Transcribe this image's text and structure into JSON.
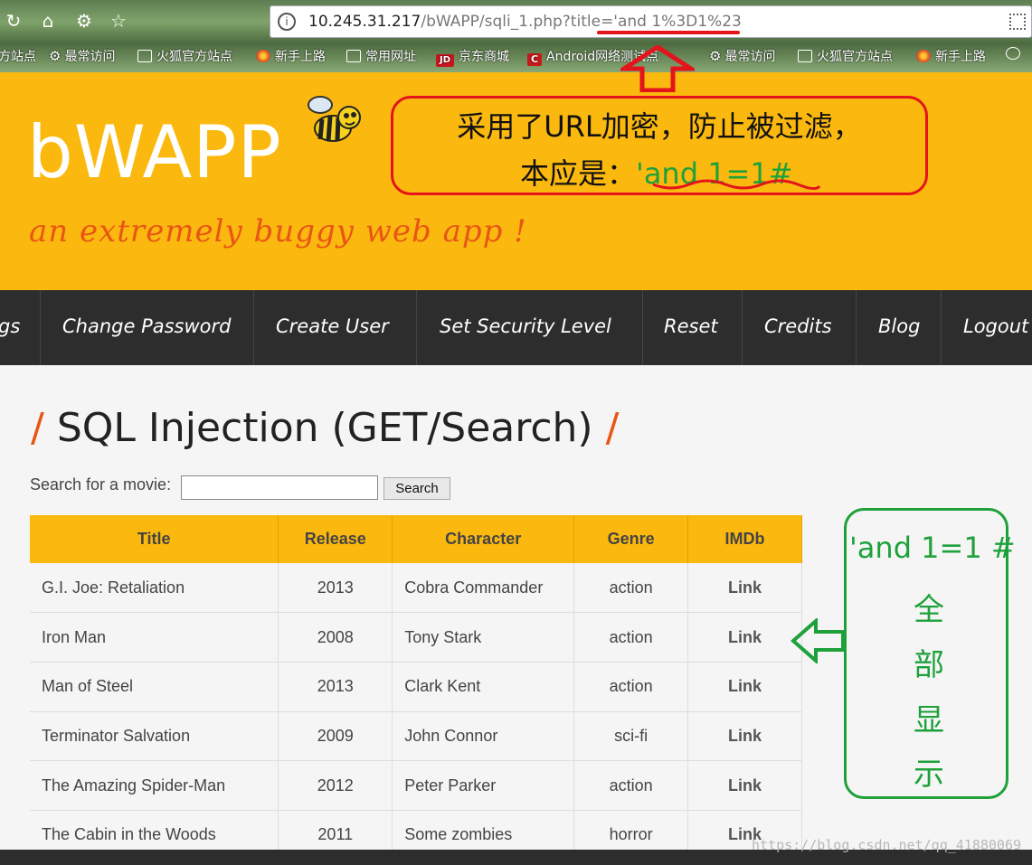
{
  "browser": {
    "url_host": "10.245.31.217",
    "url_path": "/bWAPP/sqli_1.php?title='and 1%3D1%23",
    "bookmarks": [
      "方站点",
      "最常访问",
      "火狐官方站点",
      "新手上路",
      "常用网址",
      "京东商城",
      "Android网络测试点",
      "最常访问",
      "火狐官方站点",
      "新手上路"
    ]
  },
  "header": {
    "logo": "bWAPP",
    "tagline": "an extremely buggy web app !"
  },
  "annotation_red": {
    "line1": "采用了URL加密，防止被过滤，",
    "line2_prefix": "本应是：",
    "line2_payload": "'and 1=1#"
  },
  "nav": {
    "items": [
      "gs",
      "Change Password",
      "Create User",
      "Set Security Level",
      "Reset",
      "Credits",
      "Blog",
      "Logout"
    ]
  },
  "page": {
    "title": "SQL Injection (GET/Search)",
    "search_label": "Search for a movie:",
    "search_value": "",
    "search_button": "Search"
  },
  "table": {
    "headers": [
      "Title",
      "Release",
      "Character",
      "Genre",
      "IMDb"
    ],
    "rows": [
      {
        "title": "G.I. Joe: Retaliation",
        "release": "2013",
        "character": "Cobra Commander",
        "genre": "action",
        "imdb": "Link"
      },
      {
        "title": "Iron Man",
        "release": "2008",
        "character": "Tony Stark",
        "genre": "action",
        "imdb": "Link"
      },
      {
        "title": "Man of Steel",
        "release": "2013",
        "character": "Clark Kent",
        "genre": "action",
        "imdb": "Link"
      },
      {
        "title": "Terminator Salvation",
        "release": "2009",
        "character": "John Connor",
        "genre": "sci-fi",
        "imdb": "Link"
      },
      {
        "title": "The Amazing Spider-Man",
        "release": "2012",
        "character": "Peter Parker",
        "genre": "action",
        "imdb": "Link"
      },
      {
        "title": "The Cabin in the Woods",
        "release": "2011",
        "character": "Some zombies",
        "genre": "horror",
        "imdb": "Link"
      }
    ]
  },
  "annotation_green": {
    "payload": "'and 1=1 #",
    "chars": [
      "全",
      "部",
      "显",
      "示"
    ]
  },
  "watermark": "https://blog.csdn.net/qq_41880069",
  "colors": {
    "brand_yellow": "#fbb80f",
    "accent_orange": "#e85614",
    "nav_dark": "#2d2d2d",
    "annotation_red": "#e3141b",
    "annotation_green": "#1ea13b"
  }
}
